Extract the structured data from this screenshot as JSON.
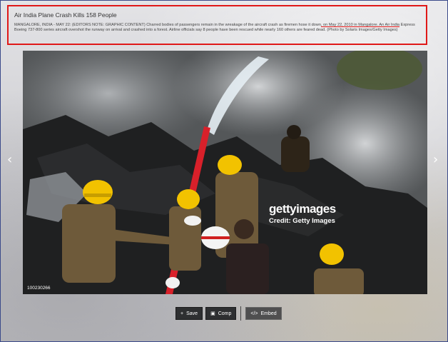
{
  "caption": {
    "title": "Air India Plane Crash Kills 158 People",
    "body_before": "MANGALORE, INDIA - MAY 22: (EDITORS NOTE: GRAPHIC CONTENT) Charred bodies of passengers remain in the wreakage of the aircraft crash as firemen hose it down",
    "body_highlight": ", on May 22, 2010 in Mangalore. An Air India",
    "body_after": " Express Boeing 737-800 series aircraft overshot the runway on arrival and crashed into a forest. Airline officials say 8 people have been rescued while nearly 160 others are feared dead. (Photo by Solaris Images/Getty Images)"
  },
  "photo": {
    "id": "100230266",
    "watermark_brand": "gettyimages",
    "watermark_credit": "Credit: Getty Images"
  },
  "nav": {
    "prev": "‹",
    "next": "›"
  },
  "actions": {
    "save": "Save",
    "save_icon": "+",
    "comp": "Comp",
    "comp_icon": "▣",
    "embed": "Embed",
    "embed_icon": "</>"
  },
  "colors": {
    "highlight_border": "#e01818",
    "helmet_yellow": "#f2c200",
    "hose_red": "#d8202a",
    "uniform_khaki": "#6e5a3a"
  }
}
